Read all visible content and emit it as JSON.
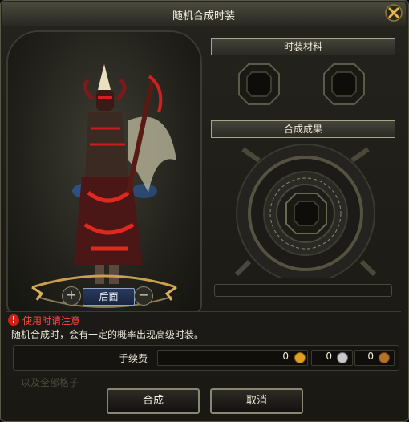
{
  "window": {
    "title": "随机合成时装"
  },
  "preview": {
    "view_label": "后面",
    "rotate_left_glyph": "+",
    "rotate_right_glyph": "−"
  },
  "materials": {
    "header": "时装材料"
  },
  "result": {
    "header": "合成成果"
  },
  "notice": {
    "warning": "使用时请注意",
    "description": "随机合成时，会有一定的概率出现高级时装。",
    "ghost_text": "以及全部格子"
  },
  "fee": {
    "label": "手续费",
    "gold": "0",
    "silver": "0",
    "bronze": "0",
    "colors": {
      "gold": "#e0a21a",
      "silver": "#c9c9c9",
      "bronze": "#b4712a"
    }
  },
  "buttons": {
    "confirm": "合成",
    "cancel": "取消"
  },
  "colors": {
    "warning": "#ff4a3c",
    "accent": "#8fa3c2"
  }
}
